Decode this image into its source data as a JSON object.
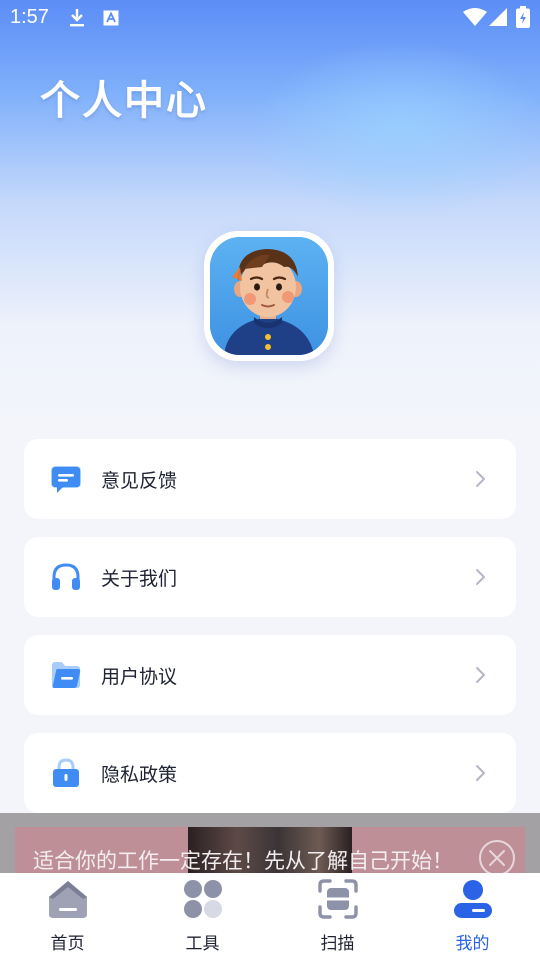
{
  "status_bar": {
    "time": "1:57",
    "icons": [
      "download-icon",
      "a-icon",
      "wifi-icon",
      "signal-icon",
      "battery-icon"
    ]
  },
  "header": {
    "title": "个人中心"
  },
  "menu": {
    "items": [
      {
        "label": "意见反馈",
        "icon": "feedback-icon"
      },
      {
        "label": "关于我们",
        "icon": "headphones-icon"
      },
      {
        "label": "用户协议",
        "icon": "folder-icon"
      },
      {
        "label": "隐私政策",
        "icon": "lock-icon"
      }
    ]
  },
  "ad": {
    "text": "适合你的工作一定存在！先从了解自己开始！"
  },
  "tabbar": {
    "items": [
      {
        "label": "首页",
        "icon": "home-icon",
        "active": false
      },
      {
        "label": "工具",
        "icon": "tools-icon",
        "active": false
      },
      {
        "label": "扫描",
        "icon": "scan-icon",
        "active": false
      },
      {
        "label": "我的",
        "icon": "profile-icon",
        "active": true
      }
    ]
  },
  "colors": {
    "accent": "#2a63e6",
    "menu_icon": "#3f8cf5",
    "tab_inactive": "#8e92a8",
    "header_top": "#5b8df7"
  }
}
